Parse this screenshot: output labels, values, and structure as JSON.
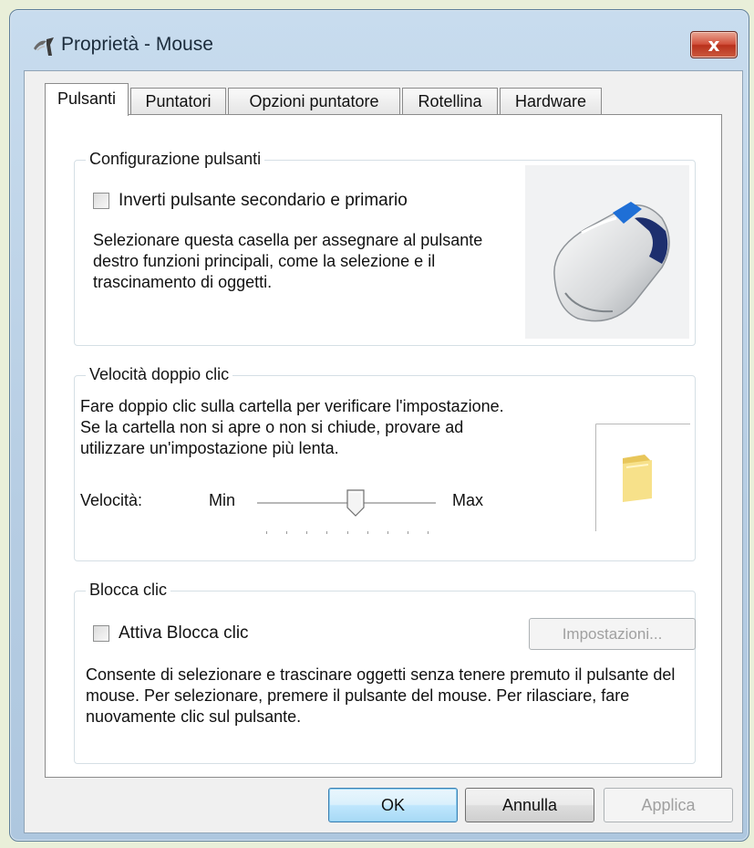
{
  "window": {
    "title": "Proprietà - Mouse",
    "close_label": "x"
  },
  "tabs": [
    {
      "label": "Pulsanti",
      "active": true
    },
    {
      "label": "Puntatori",
      "active": false
    },
    {
      "label": "Opzioni puntatore",
      "active": false
    },
    {
      "label": "Rotellina",
      "active": false
    },
    {
      "label": "Hardware",
      "active": false
    }
  ],
  "button_config": {
    "title": "Configurazione pulsanti",
    "checkbox_label": "Inverti pulsante secondario e primario",
    "checked": false,
    "description": "Selezionare questa casella per assegnare al pulsante destro funzioni principali, come la selezione e il trascinamento di oggetti."
  },
  "double_click": {
    "title": "Velocità doppio clic",
    "description": "Fare doppio clic sulla cartella per verificare l'impostazione. Se la cartella non si apre o non si chiude, provare ad utilizzare un'impostazione più lenta.",
    "speed_label": "Velocità:",
    "min_label": "Min",
    "max_label": "Max",
    "slider_value": 0.55
  },
  "click_lock": {
    "title": "Blocca clic",
    "checkbox_label": "Attiva Blocca clic",
    "checked": false,
    "settings_button": "Impostazioni...",
    "description": "Consente di selezionare e trascinare oggetti senza tenere premuto il pulsante del mouse. Per selezionare, premere il pulsante del mouse. Per rilasciare, fare nuovamente clic sul pulsante."
  },
  "footer": {
    "ok_label": "OK",
    "cancel_label": "Annulla",
    "apply_label": "Applica"
  },
  "icons": {
    "title_icon": "mouse-pointer-icon",
    "mouse_image": "mouse-icon",
    "folder_image": "folder-icon"
  }
}
